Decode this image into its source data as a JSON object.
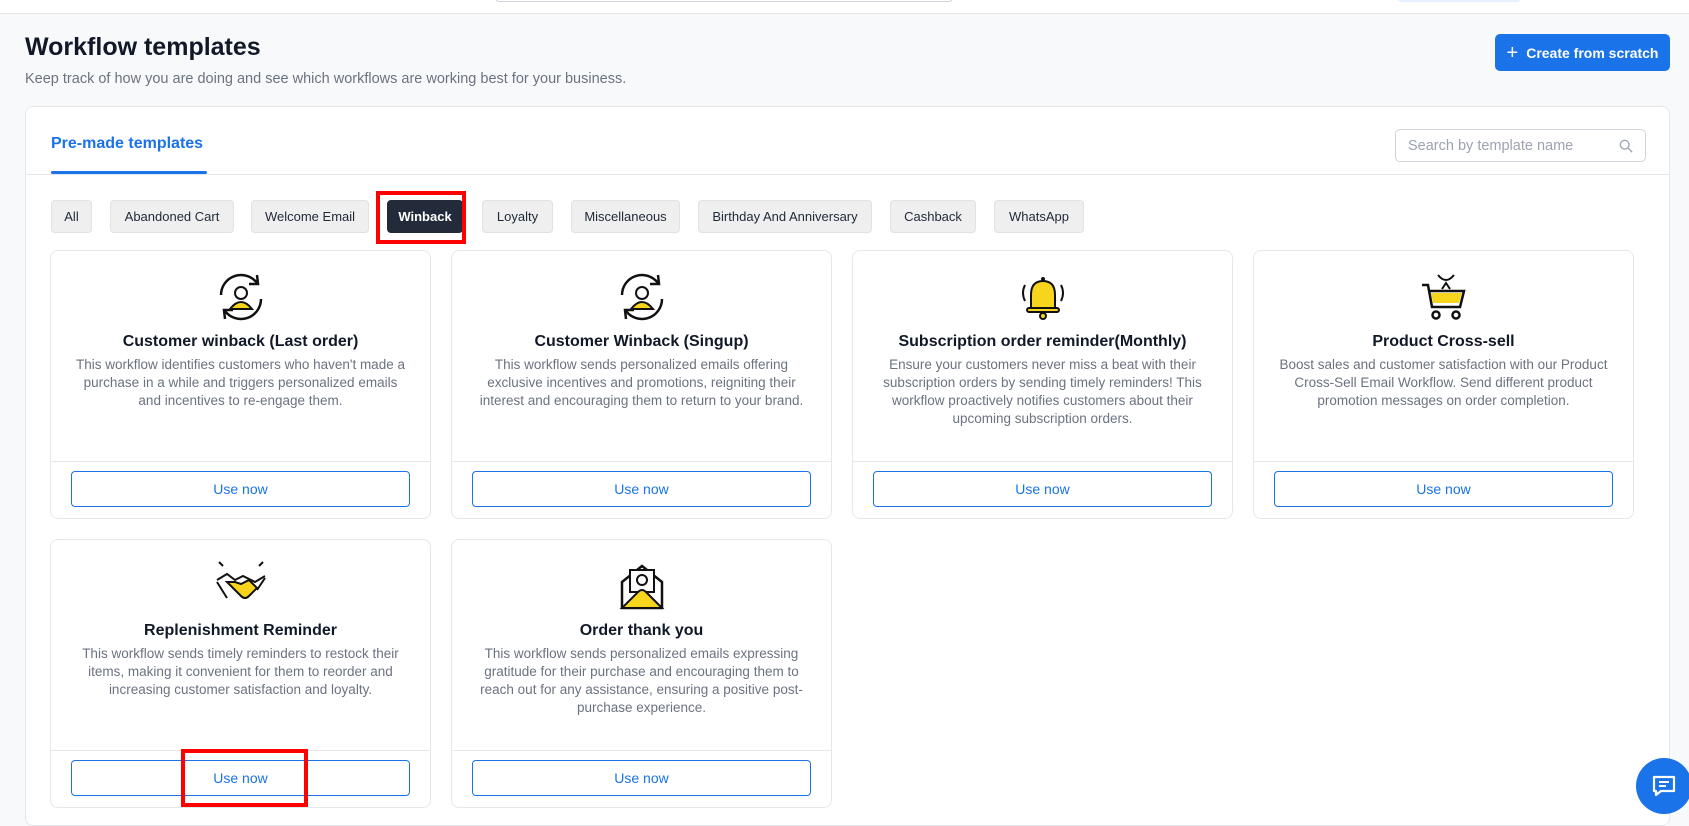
{
  "header": {
    "title": "Workflow templates",
    "subtitle": "Keep track of how you are doing and see which workflows are working best for your business.",
    "create_button": "Create from scratch"
  },
  "tabs": {
    "active": "Pre-made templates"
  },
  "search": {
    "placeholder": "Search by template name"
  },
  "filters": [
    {
      "label": "All",
      "active": false
    },
    {
      "label": "Abandoned Cart",
      "active": false
    },
    {
      "label": "Welcome Email",
      "active": false
    },
    {
      "label": "Winback",
      "active": true
    },
    {
      "label": "Loyalty",
      "active": false
    },
    {
      "label": "Miscellaneous",
      "active": false
    },
    {
      "label": "Birthday And Anniversary",
      "active": false
    },
    {
      "label": "Cashback",
      "active": false
    },
    {
      "label": "WhatsApp",
      "active": false
    }
  ],
  "cards": [
    {
      "icon": "user-refresh-icon",
      "title": "Customer winback (Last order)",
      "description": "This workflow identifies customers who haven't made a purchase in a while and triggers personalized emails and incentives to re-engage them.",
      "button": "Use now"
    },
    {
      "icon": "user-refresh-icon",
      "title": "Customer Winback (Singup)",
      "description": "This workflow sends personalized emails offering exclusive incentives and promotions, reigniting their interest and encouraging them to return to your brand.",
      "button": "Use now"
    },
    {
      "icon": "bell-icon",
      "title": "Subscription order reminder(Monthly)",
      "description": "Ensure your customers never miss a beat with their subscription orders by sending timely reminders! This workflow proactively notifies customers about their upcoming subscription orders.",
      "button": "Use now"
    },
    {
      "icon": "cart-icon",
      "title": "Product Cross-sell",
      "description": "Boost sales and customer satisfaction with our Product Cross-Sell Email Workflow. Send different product promotion messages on order completion.",
      "button": "Use now"
    },
    {
      "icon": "handshake-icon",
      "title": "Replenishment Reminder",
      "description": "This workflow sends timely reminders to restock their items, making it convenient for them to reorder and increasing customer satisfaction and loyalty.",
      "button": "Use now"
    },
    {
      "icon": "envelope-icon",
      "title": "Order thank you",
      "description": "This workflow sends personalized emails expressing gratitude for their purchase and encouraging them to reach out for any assistance, ensuring a positive post-purchase experience.",
      "button": "Use now"
    }
  ],
  "colors": {
    "accent": "#1a73e8",
    "chip_active": "#232b3b",
    "highlight": "#ff0000",
    "icon_yellow": "#f7d51d"
  }
}
